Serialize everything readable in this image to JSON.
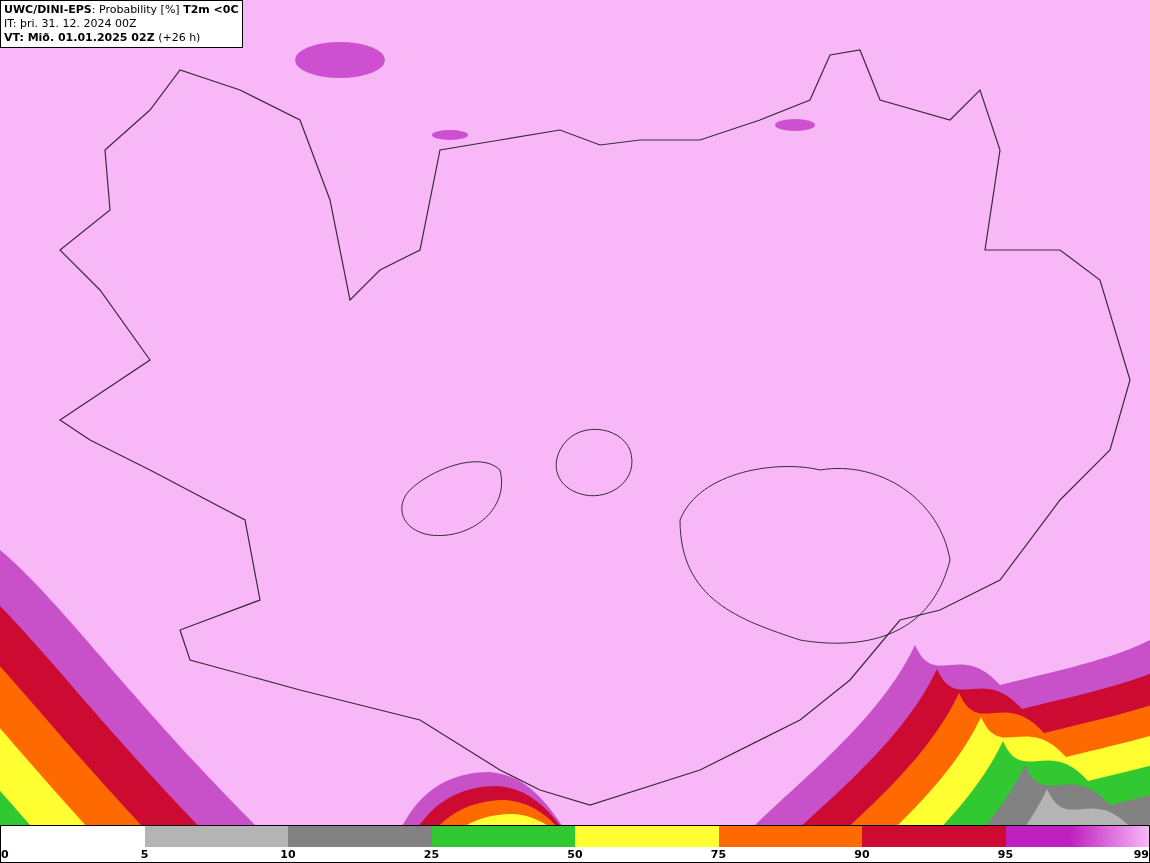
{
  "header": {
    "title": "**UWC/DINI-EPS**: Probability [%] **T2m <0C**",
    "init_time": "IT: þri. 31. 12. 2024 00Z",
    "valid_time": "**VT: Mið. 01.01.2025 02Z** (+26 h)"
  },
  "legend": {
    "segments": [
      {
        "kind": "empty"
      },
      {
        "color": "#b4b4b4"
      },
      {
        "color": "#828282"
      },
      {
        "color": "#32c832"
      },
      {
        "color": "#ffff32"
      },
      {
        "color": "#ff6a00"
      },
      {
        "color": "#cc0a32"
      },
      {
        "color": "#c020c0"
      }
    ],
    "ticks": [
      "0",
      "5",
      "10",
      "25",
      "50",
      "75",
      "90",
      "95",
      "99"
    ]
  }
}
